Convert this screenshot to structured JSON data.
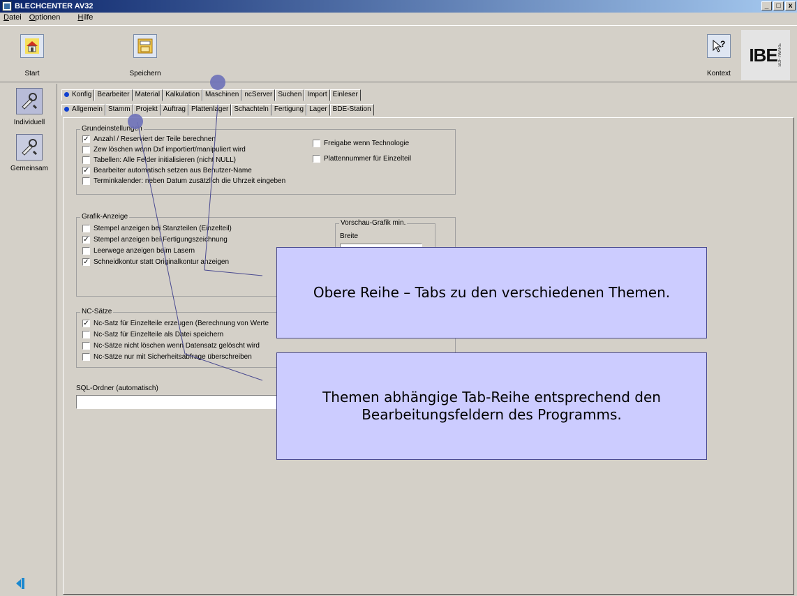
{
  "window": {
    "title": "BLECHCENTER AV32",
    "buttons": {
      "min": "_",
      "max": "□",
      "close": "x"
    }
  },
  "menu": [
    "Datei",
    "Optionen",
    "Hilfe"
  ],
  "toolbar": {
    "start_label": "Start",
    "save_label": "Speichern",
    "context_label": "Kontext",
    "logo_text": "IBE",
    "logo_sub": "SOFTWARE"
  },
  "sidebar": {
    "items": [
      {
        "label": "Individuell"
      },
      {
        "label": "Gemeinsam"
      }
    ]
  },
  "tabs_top": [
    "Konfig",
    "Bearbeiter",
    "Material",
    "Kalkulation",
    "Maschinen",
    "ncServer",
    "Suchen",
    "Import",
    "Einleser"
  ],
  "tabs_sub": [
    "Allgemein",
    "Stamm",
    "Projekt",
    "Auftrag",
    "Plattenlager",
    "Schachteln",
    "Fertigung",
    "Lager",
    "BDE-Station"
  ],
  "groups": {
    "grund": {
      "title": "Grundeinstellungen",
      "items": [
        {
          "label": "Anzahl / Reserviert der Teile berechnen",
          "checked": true
        },
        {
          "label": "Zew löschen wenn Dxf importiert/manipuliert wird",
          "checked": false
        },
        {
          "label": "Tabellen: Alle Felder initialisieren (nicht NULL)",
          "checked": false
        },
        {
          "label": "Bearbeiter automatisch setzen aus Benutzer-Name",
          "checked": true
        },
        {
          "label": "Terminkalender: neben Datum zusätzlich die Uhrzeit eingeben",
          "checked": false
        }
      ],
      "right_items": [
        {
          "label": "Freigabe wenn Technologie",
          "checked": false
        },
        {
          "label": "Plattennummer für Einzelteil",
          "checked": false
        }
      ]
    },
    "grafik": {
      "title": "Grafik-Anzeige",
      "items": [
        {
          "label": "Stempel anzeigen bei Stanzteilen (Einzelteil)",
          "checked": false
        },
        {
          "label": "Stempel anzeigen bei Fertigungszeichnung",
          "checked": true
        },
        {
          "label": "Leerwege anzeigen beim Lasern",
          "checked": false
        },
        {
          "label": "Schneidkontur statt Originalkontur anzeigen",
          "checked": true
        }
      ],
      "preview_title": "Vorschau-Grafik min.",
      "preview_width_label": "Breite"
    },
    "nc": {
      "title": "NC-Sätze",
      "items": [
        {
          "label": "Nc-Satz für Einzelteile erzeugen (Berechnung von Werte",
          "checked": true
        },
        {
          "label": "Nc-Satz für Einzelteile als Datei speichern",
          "checked": false
        },
        {
          "label": "Nc-Sätze nicht löschen wenn Datensatz gelöscht wird",
          "checked": false
        },
        {
          "label": "Nc-Sätze nur mit Sicherheitsabfrage überschreiben",
          "checked": false
        }
      ]
    }
  },
  "sql": {
    "label": "SQL-Ordner (automatisch)",
    "value": ""
  },
  "callouts": {
    "top": "Obere Reihe – Tabs zu den verschiedenen Themen.",
    "sub": "Themen abhängige Tab-Reihe entsprechend den Bearbeitungsfeldern des Programms."
  },
  "colors": {
    "callout_bg": "#ccccff",
    "marker": "#6d70b8",
    "titlebar": "#0a246a"
  },
  "icons": {
    "start": "home-icon",
    "save": "save-icon",
    "context": "context-help-icon",
    "individuell": "tools-icon",
    "gemeinsam": "tools-icon",
    "exit": "exit-arrow-icon"
  }
}
